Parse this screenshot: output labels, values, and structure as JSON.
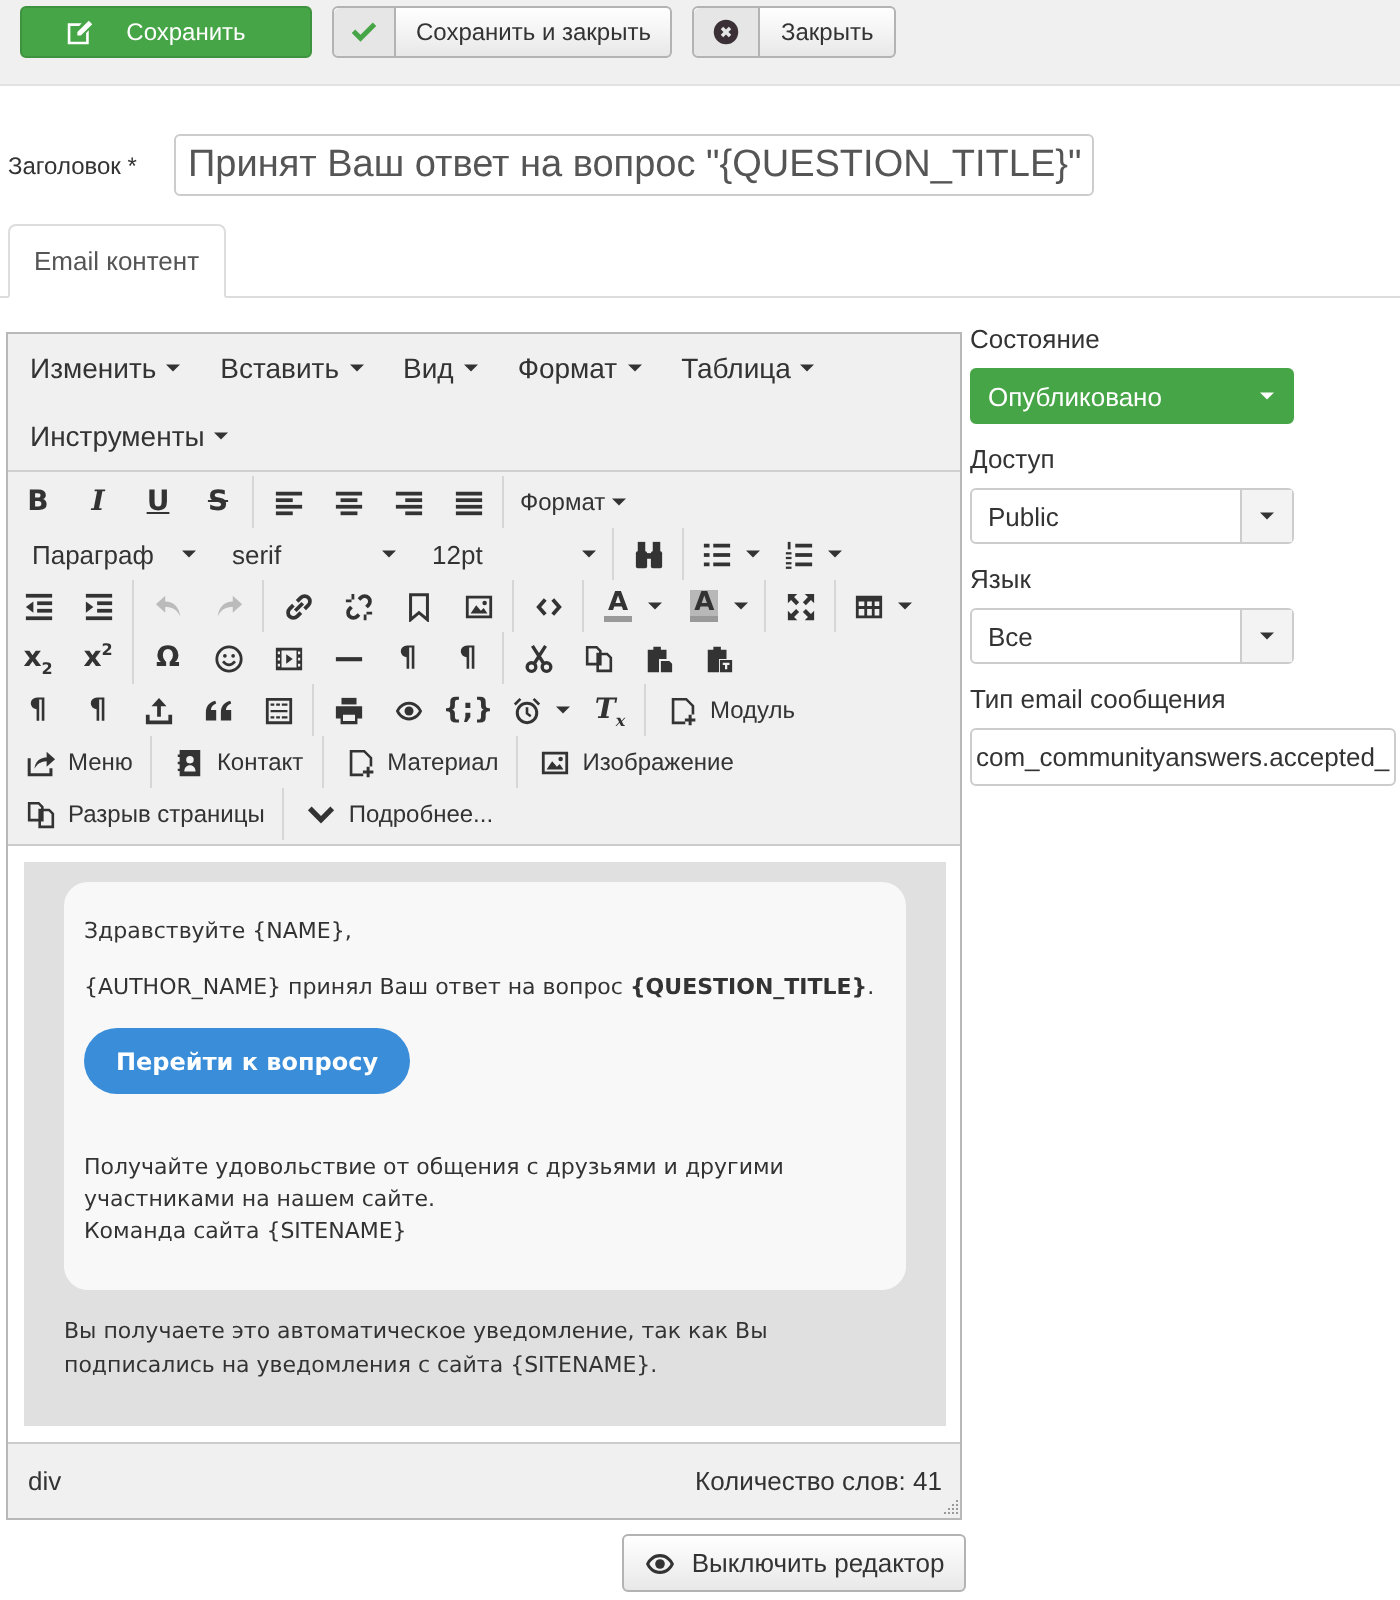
{
  "toolbar": {
    "buttons": [
      {
        "kind": "primary",
        "label": "Сохранить"
      },
      {
        "kind": "split",
        "label": "Сохранить и закрыть"
      },
      {
        "kind": "split",
        "label": "Закрыть"
      }
    ]
  },
  "title_field": {
    "label": "Заголовок *",
    "value": "Принят Ваш ответ на вопрос \"{QUESTION_TITLE}\""
  },
  "tabs": [
    {
      "label": "Email контент",
      "selected": true
    }
  ],
  "editor": {
    "menubar": [
      "Изменить",
      "Вставить",
      "Вид",
      "Формат",
      "Таблица",
      "Инструменты"
    ],
    "toolbar": [
      [
        [
          {
            "kind": "glyph",
            "label": "B",
            "disabled": false
          },
          {
            "kind": "italic",
            "label": "I",
            "disabled": false
          },
          {
            "kind": "underline",
            "label": "U",
            "disabled": false
          },
          {
            "kind": "strike",
            "label": "S",
            "disabled": false
          }
        ],
        [
          {
            "kind": "icon",
            "disabled": false
          },
          {
            "kind": "icon",
            "disabled": false
          },
          {
            "kind": "icon",
            "disabled": false
          },
          {
            "kind": "icon",
            "disabled": false
          }
        ],
        [
          {
            "kind": "menu",
            "label": "Формат",
            "disabled": false
          }
        ]
      ],
      [
        [
          {
            "kind": "select",
            "label": "Параграф",
            "disabled": false
          },
          {
            "kind": "select",
            "label": "serif",
            "disabled": false
          },
          {
            "kind": "select",
            "label": "12pt",
            "disabled": false
          }
        ],
        [
          {
            "kind": "icon",
            "disabled": false
          }
        ],
        [
          {
            "kind": "iconmenu",
            "disabled": false
          },
          {
            "kind": "iconmenu",
            "disabled": false
          }
        ]
      ],
      [
        [
          {
            "kind": "icon",
            "disabled": false
          },
          {
            "kind": "icon",
            "disabled": false
          }
        ],
        [
          {
            "kind": "icon",
            "disabled": true
          },
          {
            "kind": "icon",
            "disabled": true
          }
        ],
        [
          {
            "kind": "icon",
            "disabled": false
          },
          {
            "kind": "icon",
            "disabled": false
          },
          {
            "kind": "icon",
            "disabled": false
          },
          {
            "kind": "icon",
            "disabled": false
          }
        ],
        [
          {
            "kind": "icon",
            "disabled": false
          }
        ],
        [
          {
            "kind": "color",
            "label": "A",
            "disabled": false
          },
          {
            "kind": "highlight",
            "label": "A",
            "disabled": false
          }
        ],
        [
          {
            "kind": "icon",
            "disabled": false
          }
        ],
        [
          {
            "kind": "iconmenu",
            "disabled": false
          }
        ]
      ],
      [
        [
          {
            "kind": "glyph",
            "label": "x$_{2}$",
            "disabled": false
          },
          {
            "kind": "glyph",
            "label": "x$^{2}$",
            "disabled": false
          }
        ],
        [
          {
            "kind": "glyph",
            "label": "Ω",
            "disabled": false
          },
          {
            "kind": "icon",
            "disabled": false
          },
          {
            "kind": "icon",
            "disabled": false
          },
          {
            "kind": "icon",
            "disabled": false
          },
          {
            "kind": "glyph",
            "label": "¶",
            "disabled": false
          },
          {
            "kind": "glyph",
            "label": "¶",
            "disabled": false
          }
        ],
        [
          {
            "kind": "icon",
            "disabled": false
          },
          {
            "kind": "icon",
            "disabled": false
          },
          {
            "kind": "icon",
            "disabled": false
          },
          {
            "kind": "icon",
            "disabled": false
          }
        ]
      ],
      [
        [
          {
            "kind": "glyph",
            "label": "¶",
            "disabled": false
          },
          {
            "kind": "glyph",
            "label": "¶",
            "disabled": false
          },
          {
            "kind": "icon",
            "disabled": false
          },
          {
            "kind": "icon",
            "disabled": false
          },
          {
            "kind": "icon",
            "disabled": false
          }
        ],
        [
          {
            "kind": "icon",
            "disabled": false
          },
          {
            "kind": "icon",
            "disabled": false
          },
          {
            "kind": "glyph",
            "label": "{;}",
            "disabled": false
          },
          {
            "kind": "iconmenu",
            "disabled": false
          },
          {
            "kind": "italic",
            "label": "T$_{x}$",
            "disabled": false
          }
        ],
        [
          {
            "kind": "labeled",
            "label": "Модуль",
            "disabled": false
          }
        ]
      ],
      [
        [
          {
            "kind": "labeled",
            "label": "Меню",
            "disabled": false
          }
        ],
        [
          {
            "kind": "labeled",
            "label": "Контакт",
            "disabled": false
          }
        ],
        [
          {
            "kind": "labeled",
            "label": "Материал",
            "disabled": false
          }
        ],
        [
          {
            "kind": "labeled",
            "label": "Изображение",
            "disabled": false
          }
        ]
      ],
      [
        [
          {
            "kind": "labeled",
            "label": "Разрыв страницы",
            "disabled": false
          }
        ],
        [
          {
            "kind": "labeled",
            "label": "Подробнее...",
            "disabled": false
          }
        ]
      ]
    ],
    "email": {
      "greeting": "Здравствуйте {NAME},",
      "message": "{AUTHOR_NAME} принял Ваш ответ на вопрос **{QUESTION_TITLE}**.",
      "button": "Перейти к вопросу",
      "closing": "Получайте удовольствие от общения с друзьями и другими участниками на нашем сайте.",
      "signature": "Команда сайта {SITENAME}",
      "footer": "Вы получаете это автоматическое уведомление, так как Вы подписались на уведомления с сайта {SITENAME}."
    },
    "status_bar": {
      "path": "div",
      "word_count": "Количество слов: 41"
    }
  },
  "toggle_button": {
    "label": "Выключить редактор"
  },
  "sidebar": {
    "fields": [
      {
        "kind": "status",
        "label": "Состояние",
        "value": "Опубликовано"
      },
      {
        "kind": "select",
        "label": "Доступ",
        "value": "Public"
      },
      {
        "kind": "select",
        "label": "Язык",
        "value": "Все"
      },
      {
        "kind": "text",
        "label": "Тип email сообщения",
        "value": "com_communityanswers.accepted_"
      }
    ]
  }
}
